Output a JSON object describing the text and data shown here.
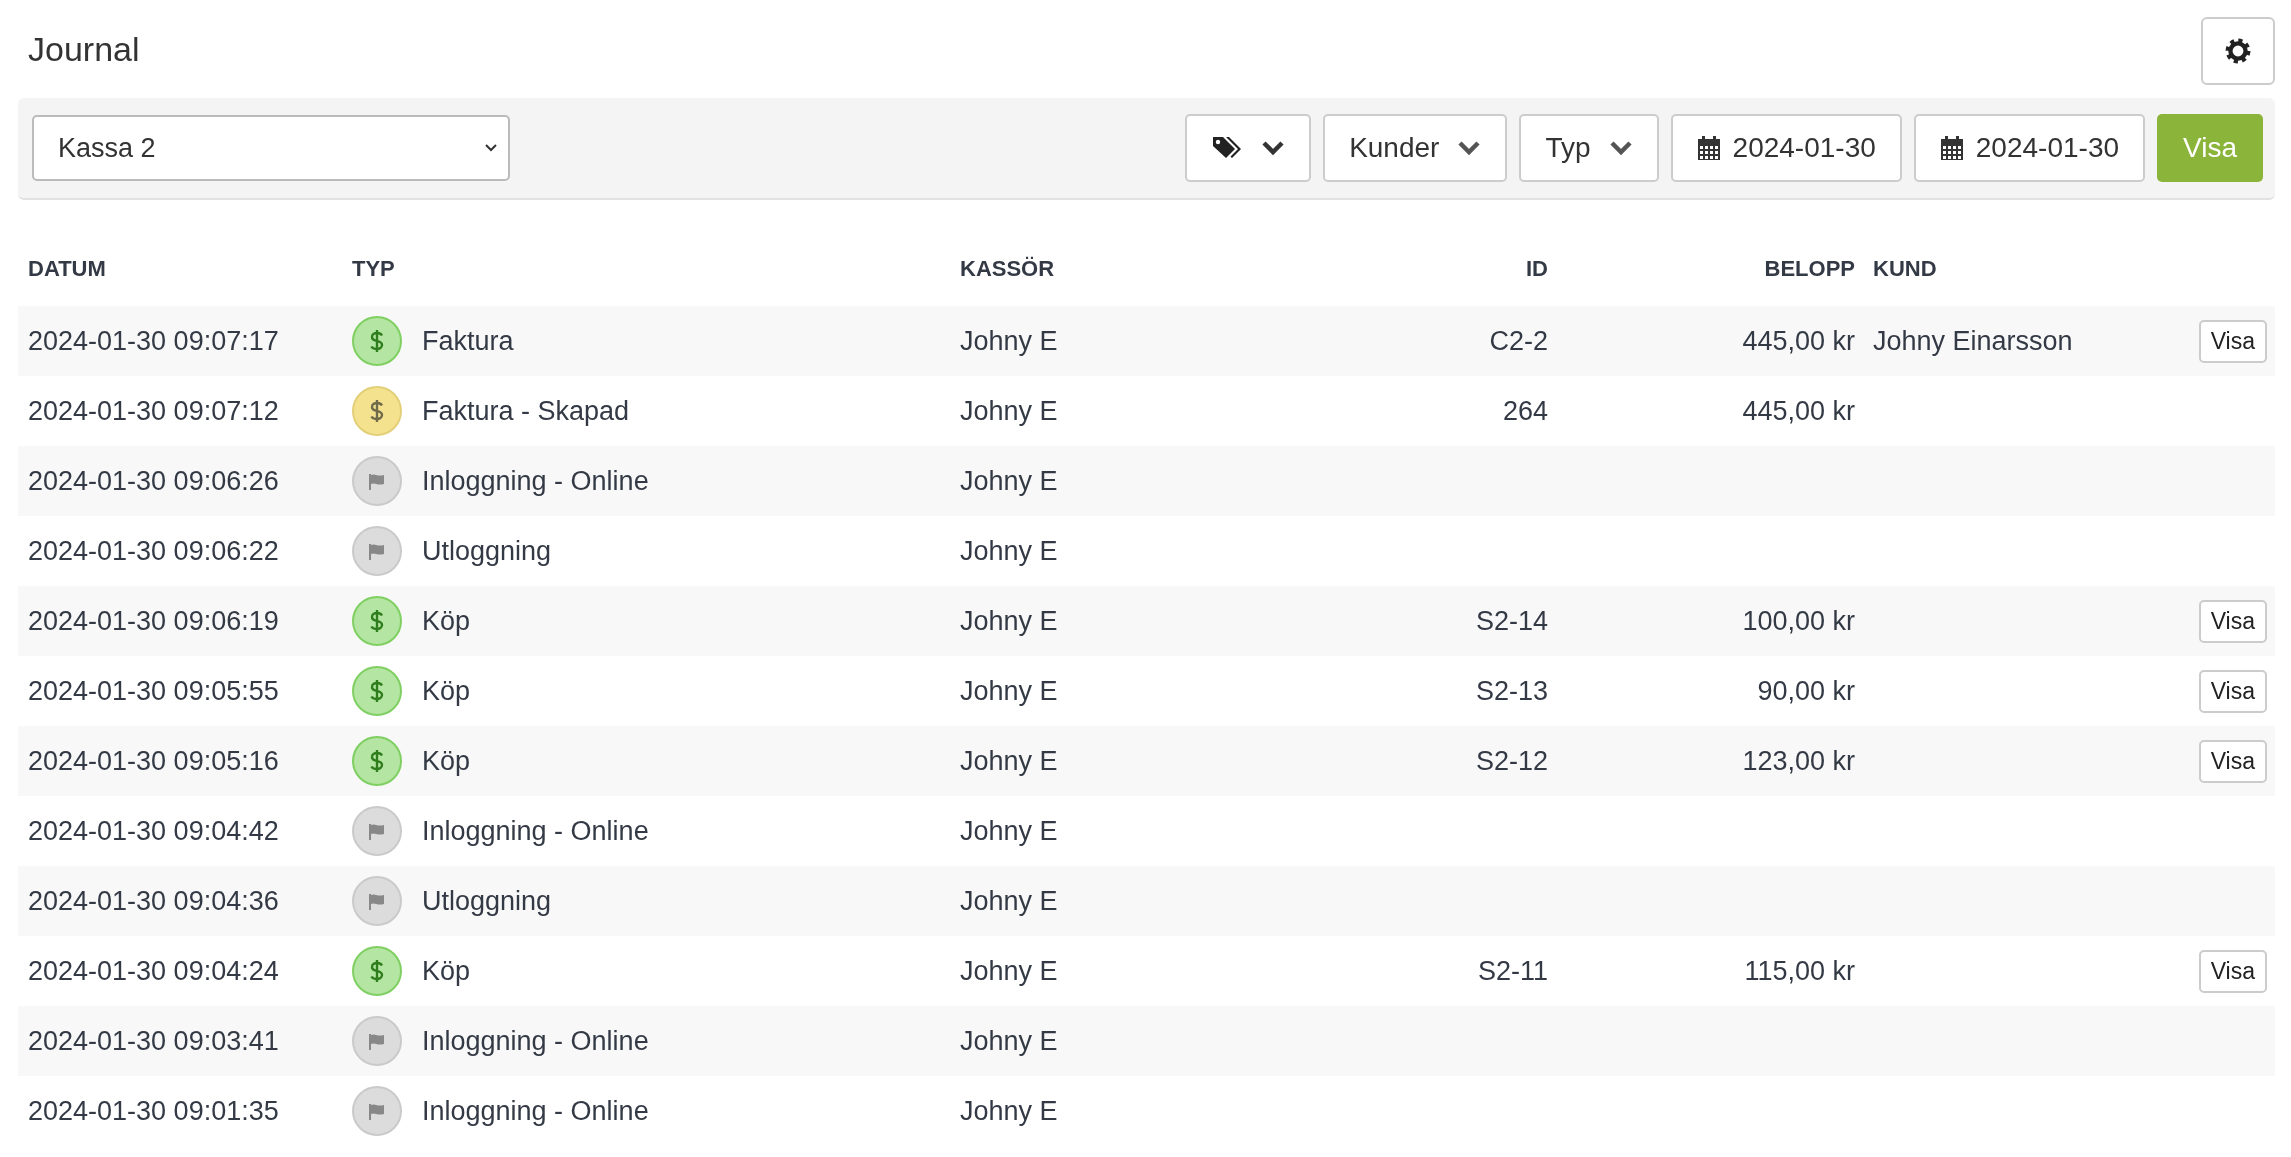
{
  "page": {
    "title": "Journal"
  },
  "toolbar": {
    "register_select": {
      "value": "Kassa 2"
    },
    "filters": [
      {
        "kind": "tags"
      },
      {
        "kind": "dropdown",
        "label": "Kunder"
      },
      {
        "kind": "dropdown",
        "label": "Typ"
      },
      {
        "kind": "date",
        "value": "2024-01-30"
      },
      {
        "kind": "date",
        "value": "2024-01-30"
      }
    ],
    "submit_button": "Visa"
  },
  "table": {
    "columns": [
      "DATUM",
      "TYP",
      "KASSÖR",
      "ID",
      "BELOPP",
      "KUND"
    ],
    "rows": [
      {
        "datum": "2024-01-30 09:07:17",
        "kind": "paid",
        "typ": "Faktura",
        "kassor": "Johny E",
        "id": "C2-2",
        "belopp": "445,00 kr",
        "kund": "Johny Einarsson",
        "action": "Visa"
      },
      {
        "datum": "2024-01-30 09:07:12",
        "kind": "created",
        "typ": "Faktura - Skapad",
        "kassor": "Johny E",
        "id": "264",
        "belopp": "445,00 kr"
      },
      {
        "datum": "2024-01-30 09:06:26",
        "kind": "event",
        "typ": "Inloggning - Online",
        "kassor": "Johny E"
      },
      {
        "datum": "2024-01-30 09:06:22",
        "kind": "event",
        "typ": "Utloggning",
        "kassor": "Johny E"
      },
      {
        "datum": "2024-01-30 09:06:19",
        "kind": "paid",
        "typ": "Köp",
        "kassor": "Johny E",
        "id": "S2-14",
        "belopp": "100,00 kr",
        "action": "Visa"
      },
      {
        "datum": "2024-01-30 09:05:55",
        "kind": "paid",
        "typ": "Köp",
        "kassor": "Johny E",
        "id": "S2-13",
        "belopp": "90,00 kr",
        "action": "Visa"
      },
      {
        "datum": "2024-01-30 09:05:16",
        "kind": "paid",
        "typ": "Köp",
        "kassor": "Johny E",
        "id": "S2-12",
        "belopp": "123,00 kr",
        "action": "Visa"
      },
      {
        "datum": "2024-01-30 09:04:42",
        "kind": "event",
        "typ": "Inloggning - Online",
        "kassor": "Johny E"
      },
      {
        "datum": "2024-01-30 09:04:36",
        "kind": "event",
        "typ": "Utloggning",
        "kassor": "Johny E"
      },
      {
        "datum": "2024-01-30 09:04:24",
        "kind": "paid",
        "typ": "Köp",
        "kassor": "Johny E",
        "id": "S2-11",
        "belopp": "115,00 kr",
        "action": "Visa"
      },
      {
        "datum": "2024-01-30 09:03:41",
        "kind": "event",
        "typ": "Inloggning - Online",
        "kassor": "Johny E"
      },
      {
        "datum": "2024-01-30 09:01:35",
        "kind": "event",
        "typ": "Inloggning - Online",
        "kassor": "Johny E"
      }
    ]
  }
}
